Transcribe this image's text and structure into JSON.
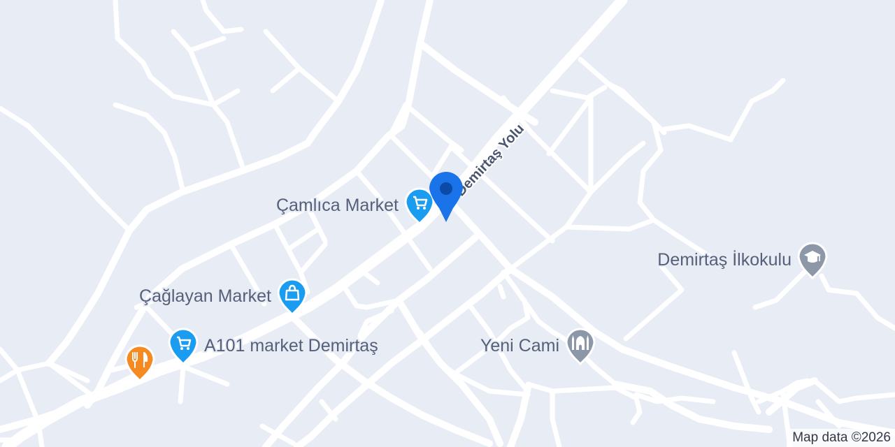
{
  "map": {
    "road_label": "Demirtaş Yolu",
    "attribution": "Map data ©2026",
    "colors": {
      "background": "#e8ecf5",
      "road": "#ffffff",
      "shopping": "#1a9cf0",
      "restaurant": "#f58a22",
      "school": "#8c98a8",
      "mosque": "#8c98a8",
      "location_pin": "#1a73e8"
    },
    "pois": [
      {
        "label": "Çamlıca Market",
        "icon": "shopping-cart-icon",
        "category": "shopping"
      },
      {
        "label": "Çağlayan Market",
        "icon": "shopping-bag-icon",
        "category": "shopping"
      },
      {
        "label": "A101 market Demirtaş",
        "icon": "shopping-cart-icon",
        "category": "shopping"
      },
      {
        "label": "",
        "icon": "fork-knife-icon",
        "category": "restaurant"
      },
      {
        "label": "Demirtaş İlkokulu",
        "icon": "graduation-cap-icon",
        "category": "school"
      },
      {
        "label": "Yeni Cami",
        "icon": "mosque-icon",
        "category": "mosque"
      }
    ],
    "location_pin": {
      "icon": "location-pin-icon"
    }
  }
}
